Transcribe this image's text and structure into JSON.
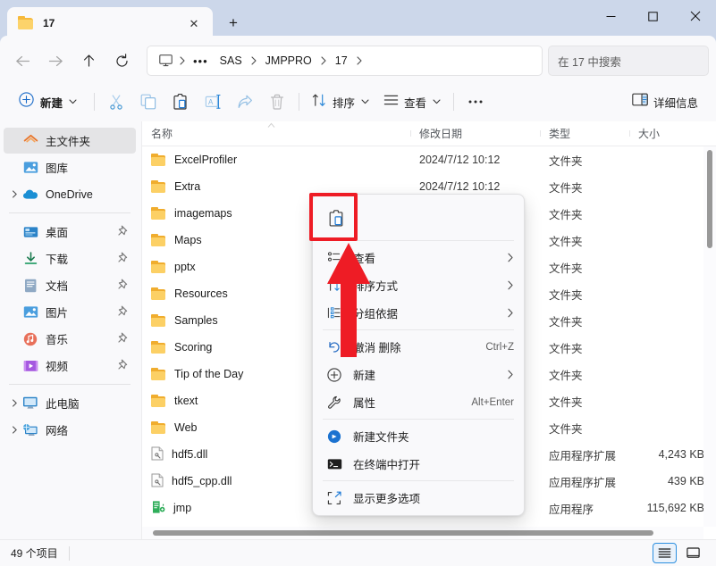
{
  "window": {
    "tab_title": "17",
    "tab_close_label": "✕",
    "new_tab_label": "+",
    "minimize_label": "—",
    "maximize_label": "▢",
    "close_label": "✕"
  },
  "address": {
    "back_icon": "back-arrow-icon",
    "forward_icon": "forward-arrow-icon",
    "up_icon": "up-arrow-icon",
    "refresh_icon": "refresh-icon",
    "breadcrumbs": [
      "SAS",
      "JMPPRO",
      "17"
    ],
    "overflow_label": "•••",
    "search_placeholder": "在 17 中搜索"
  },
  "toolbar": {
    "new_label": "新建",
    "cut_icon": "scissors-icon",
    "copy_icon": "copy-icon",
    "paste_icon": "paste-icon",
    "rename_icon": "rename-icon",
    "share_icon": "share-icon",
    "delete_icon": "trash-icon",
    "sort_label": "排序",
    "view_label": "查看",
    "more_label": "•••",
    "details_label": "详细信息"
  },
  "sidebar": {
    "items": [
      {
        "label": "主文件夹",
        "icon": "home-icon",
        "selected": true,
        "expandable": false,
        "pinned": false
      },
      {
        "label": "图库",
        "icon": "gallery-icon",
        "selected": false,
        "expandable": false,
        "pinned": false
      },
      {
        "label": "OneDrive",
        "icon": "onedrive-icon",
        "selected": false,
        "expandable": true,
        "pinned": false
      },
      {
        "divider": true
      },
      {
        "label": "桌面",
        "icon": "desktop-icon",
        "selected": false,
        "expandable": false,
        "pinned": true
      },
      {
        "label": "下载",
        "icon": "downloads-icon",
        "selected": false,
        "expandable": false,
        "pinned": true
      },
      {
        "label": "文档",
        "icon": "documents-icon",
        "selected": false,
        "expandable": false,
        "pinned": true
      },
      {
        "label": "图片",
        "icon": "pictures-icon",
        "selected": false,
        "expandable": false,
        "pinned": true
      },
      {
        "label": "音乐",
        "icon": "music-icon",
        "selected": false,
        "expandable": false,
        "pinned": true
      },
      {
        "label": "视频",
        "icon": "videos-icon",
        "selected": false,
        "expandable": false,
        "pinned": true
      },
      {
        "divider": true
      },
      {
        "label": "此电脑",
        "icon": "thispc-icon",
        "selected": false,
        "expandable": true,
        "pinned": false
      },
      {
        "label": "网络",
        "icon": "network-icon",
        "selected": false,
        "expandable": true,
        "pinned": false
      }
    ]
  },
  "filelist": {
    "columns": [
      "名称",
      "修改日期",
      "类型",
      "大小"
    ],
    "rows": [
      {
        "name": "ExcelProfiler",
        "date": "2024/7/12 10:12",
        "type": "文件夹",
        "size": "",
        "icon": "folder-icon"
      },
      {
        "name": "Extra",
        "date": "2024/7/12 10:12",
        "type": "文件夹",
        "size": "",
        "icon": "folder-icon"
      },
      {
        "name": "imagemaps",
        "date": "",
        "type": "文件夹",
        "size": "",
        "icon": "folder-icon"
      },
      {
        "name": "Maps",
        "date": "",
        "type": "文件夹",
        "size": "",
        "icon": "folder-icon"
      },
      {
        "name": "pptx",
        "date": "",
        "type": "文件夹",
        "size": "",
        "icon": "folder-icon"
      },
      {
        "name": "Resources",
        "date": "",
        "type": "文件夹",
        "size": "",
        "icon": "folder-icon"
      },
      {
        "name": "Samples",
        "date": "",
        "type": "文件夹",
        "size": "",
        "icon": "folder-icon"
      },
      {
        "name": "Scoring",
        "date": "",
        "type": "文件夹",
        "size": "",
        "icon": "folder-icon"
      },
      {
        "name": "Tip of the Day",
        "date": "",
        "type": "文件夹",
        "size": "",
        "icon": "folder-icon"
      },
      {
        "name": "tkext",
        "date": "",
        "type": "文件夹",
        "size": "",
        "icon": "folder-icon"
      },
      {
        "name": "Web",
        "date": "",
        "type": "文件夹",
        "size": "",
        "icon": "folder-icon"
      },
      {
        "name": "hdf5.dll",
        "date": "",
        "type": "应用程序扩展",
        "size": "4,243 KB",
        "icon": "dll-icon"
      },
      {
        "name": "hdf5_cpp.dll",
        "date": "",
        "type": "应用程序扩展",
        "size": "439 KB",
        "icon": "dll-icon"
      },
      {
        "name": "jmp",
        "date": "",
        "type": "应用程序",
        "size": "115,692 KB",
        "icon": "app-icon"
      }
    ]
  },
  "context_menu": {
    "top_icons": [
      {
        "name": "paste-icon",
        "label": "粘贴"
      }
    ],
    "items": [
      {
        "label": "查看",
        "icon": "view-icon",
        "accel": "",
        "submenu": true
      },
      {
        "label": "排序方式",
        "icon": "sort-icon",
        "accel": "",
        "submenu": true
      },
      {
        "label": "分组依据",
        "icon": "group-icon",
        "accel": "",
        "submenu": true
      },
      {
        "divider": true
      },
      {
        "label": "撤消 删除",
        "icon": "undo-icon",
        "accel": "Ctrl+Z",
        "submenu": false
      },
      {
        "label": "新建",
        "icon": "new-icon",
        "accel": "",
        "submenu": true
      },
      {
        "label": "属性",
        "icon": "properties-icon",
        "accel": "Alt+Enter",
        "submenu": false
      },
      {
        "divider": true
      },
      {
        "label": "新建文件夹",
        "icon": "new-folder-icon",
        "accel": "",
        "submenu": false
      },
      {
        "label": "在终端中打开",
        "icon": "terminal-icon",
        "accel": "",
        "submenu": false
      },
      {
        "divider": true
      },
      {
        "label": "显示更多选项",
        "icon": "more-options-icon",
        "accel": "",
        "submenu": false
      }
    ]
  },
  "statusbar": {
    "item_count": "49 个项目",
    "details_view_icon": "details-view-icon",
    "large_icons_view_icon": "large-icons-view-icon"
  },
  "annotation": {
    "highlight_color": "#ee1c25",
    "arrow_color": "#ee1c25",
    "target": "paste-icon"
  }
}
